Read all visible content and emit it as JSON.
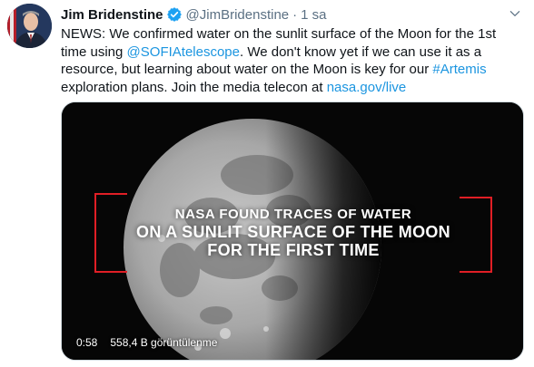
{
  "tweet": {
    "author_name": "Jim Bridenstine",
    "handle": "@JimBridenstine",
    "separator": "·",
    "time": "1 sa",
    "text_parts": [
      {
        "text": "NEWS: We confirmed water on the sunlit surface of the Moon for the 1st time using ",
        "type": "plain"
      },
      {
        "text": "@SOFIAtelescope",
        "type": "link"
      },
      {
        "text": ". We don't know yet if we can use it as a resource, but learning about water on the Moon is key for our ",
        "type": "plain"
      },
      {
        "text": "#Artemis",
        "type": "link"
      },
      {
        "text": " exploration plans. Join the media telecon at ",
        "type": "plain"
      },
      {
        "text": "nasa.gov/live",
        "type": "link"
      }
    ]
  },
  "video": {
    "overlay_line1": "NASA FOUND TRACES OF WATER",
    "overlay_line2": "ON A SUNLIT SURFACE OF THE MOON",
    "overlay_line3": "FOR THE FIRST TIME",
    "duration": "0:58",
    "views": "558,4 B görüntülenme"
  },
  "icons": {
    "verified": "verified-badge-icon",
    "more": "more-chevron-icon"
  },
  "colors": {
    "link": "#1b95e0",
    "accent_red": "#e01e25"
  }
}
